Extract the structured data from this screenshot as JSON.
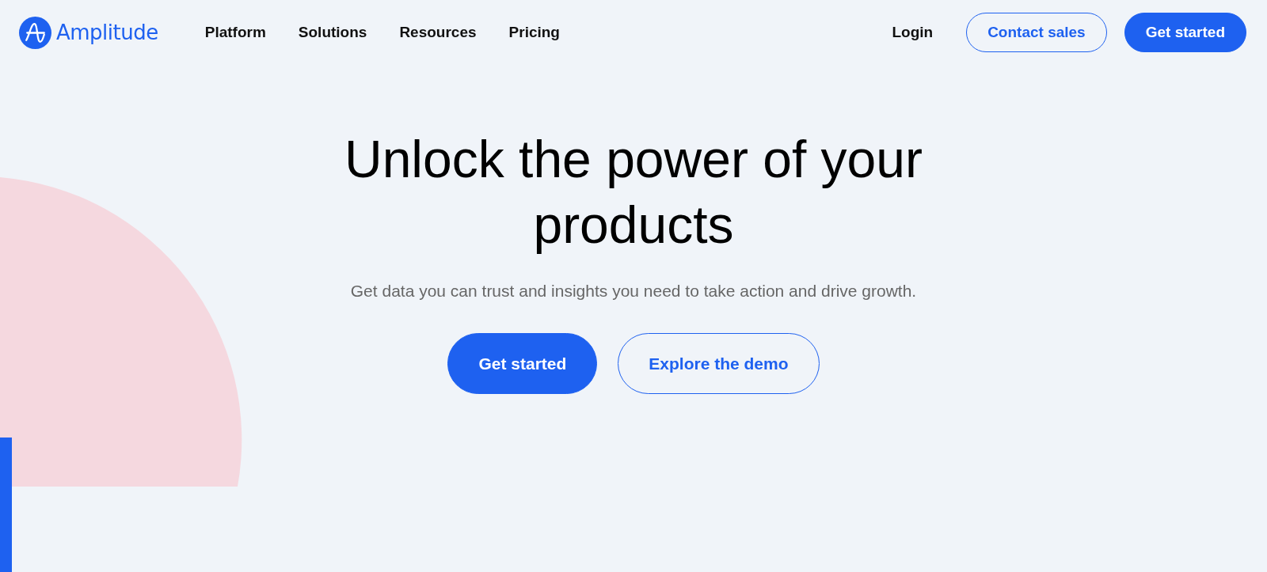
{
  "header": {
    "logo": "Amplitude",
    "nav": [
      "Platform",
      "Solutions",
      "Resources",
      "Pricing"
    ],
    "actions": [
      {
        "label": "Login",
        "kind": "link"
      },
      {
        "label": "Contact sales",
        "kind": "outline"
      },
      {
        "label": "Get started",
        "kind": "primary"
      }
    ]
  },
  "hero": {
    "title": "Unlock the power of your products",
    "subtitle": "Get data you can trust and insights you need to take action and drive growth.",
    "buttons": [
      {
        "label": "Get started",
        "kind": "primary"
      },
      {
        "label": "Explore the demo",
        "kind": "outline"
      }
    ]
  }
}
